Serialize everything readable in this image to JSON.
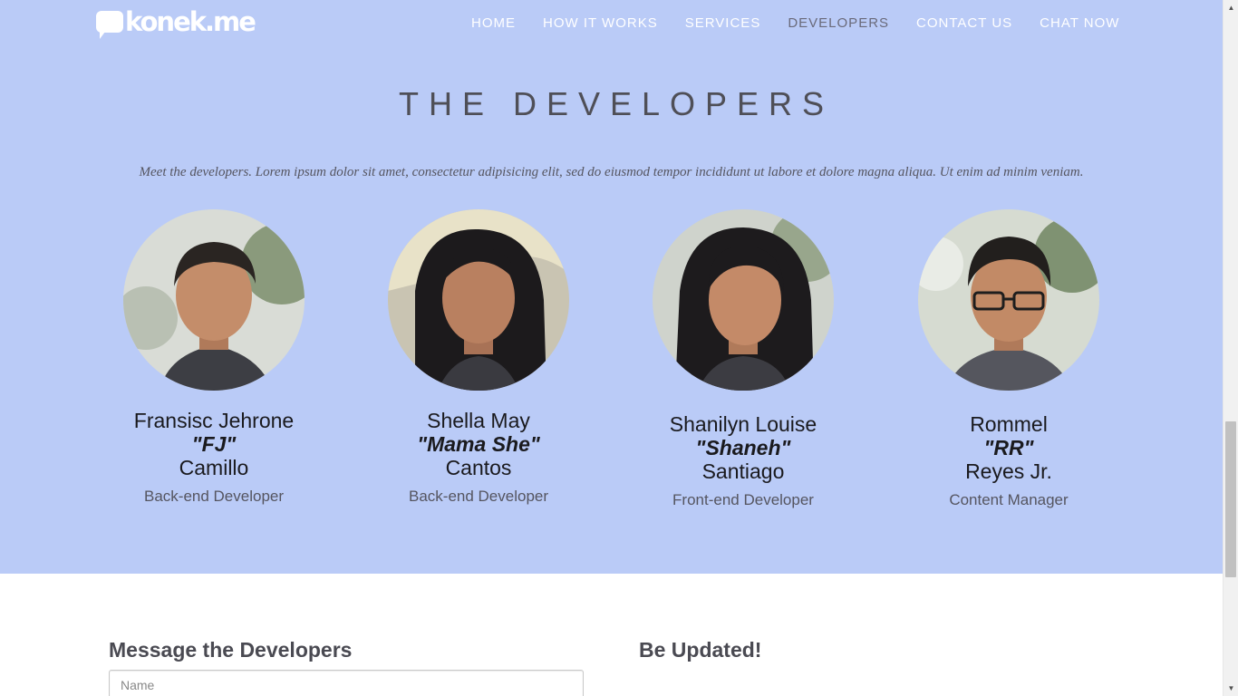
{
  "brand": {
    "logo_text": "konek.me"
  },
  "nav": {
    "items": [
      {
        "label": "HOME"
      },
      {
        "label": "HOW IT WORKS"
      },
      {
        "label": "SERVICES"
      },
      {
        "label": "DEVELOPERS"
      },
      {
        "label": "CONTACT US"
      },
      {
        "label": "CHAT NOW"
      }
    ],
    "active": "DEVELOPERS"
  },
  "section": {
    "title": "THE DEVELOPERS",
    "intro": "Meet the developers. Lorem ipsum dolor sit amet, consectetur adipisicing elit, sed do eiusmod tempor incididunt ut labore et dolore magna aliqua. Ut enim ad minim veniam."
  },
  "developers": [
    {
      "first": "Fransisc Jehrone",
      "nick": "\"FJ\"",
      "last": "Camillo",
      "role": "Back-end Developer"
    },
    {
      "first": "Shella May",
      "nick": "\"Mama She\"",
      "last": "Cantos",
      "role": "Back-end Developer"
    },
    {
      "first": "Shanilyn Louise",
      "nick": "\"Shaneh\"",
      "last": "Santiago",
      "role": "Front-end Developer"
    },
    {
      "first": "Rommel",
      "nick": "\"RR\"",
      "last": "Reyes Jr.",
      "role": "Content Manager"
    }
  ],
  "contact": {
    "message_title": "Message the Developers",
    "name_placeholder": "Name",
    "updates_title": "Be Updated!"
  },
  "colors": {
    "hero_bg": "#bacbf7",
    "nav_active": "#6a6a7a"
  }
}
